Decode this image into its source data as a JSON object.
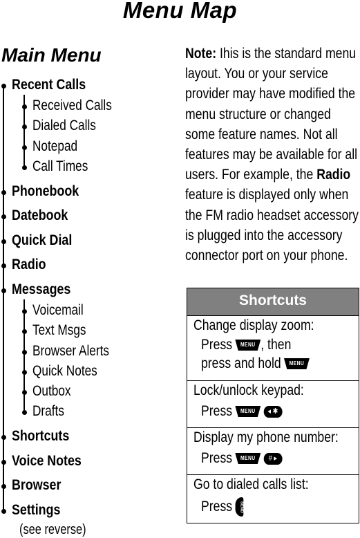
{
  "page_title": "Menu Map",
  "section_title": "Main Menu",
  "menu": [
    {
      "label": "Recent Calls",
      "children": [
        "Received Calls",
        "Dialed Calls",
        "Notepad",
        "Call Times"
      ]
    },
    {
      "label": "Phonebook",
      "children": []
    },
    {
      "label": "Datebook",
      "children": []
    },
    {
      "label": "Quick Dial",
      "children": []
    },
    {
      "label": "Radio",
      "children": []
    },
    {
      "label": "Messages",
      "children": [
        "Voicemail",
        "Text Msgs",
        "Browser Alerts",
        "Quick Notes",
        "Outbox",
        "Drafts"
      ]
    },
    {
      "label": "Shortcuts",
      "children": []
    },
    {
      "label": "Voice Notes",
      "children": []
    },
    {
      "label": "Browser",
      "children": []
    },
    {
      "label": "Settings",
      "children": [],
      "note": "(see reverse)"
    }
  ],
  "note": {
    "label": "Note:",
    "text_1": " Ihis is the standard menu layout. You or your service provider may have modified the menu structure or changed some feature names. Not all features may be available for all users. For example, the ",
    "bold": "Radio",
    "text_2": " feature is displayed only when the FM radio headset accessory is plugged into the accessory connector port on your phone."
  },
  "shortcuts": {
    "header": "Shortcuts",
    "rows": [
      {
        "label": "Change display zoom:",
        "line1": "Press",
        "line1_after": ", then",
        "line2": "press and hold"
      },
      {
        "label": "Lock/unlock keypad:",
        "line1": "Press"
      },
      {
        "label": "Display my phone number:",
        "line1": "Press"
      },
      {
        "label": "Go to dialed calls list:",
        "line1": "Press"
      }
    ],
    "keys": {
      "menu": "MENU",
      "star": "◂ ✱",
      "pound": "# ▸",
      "send": "SEND"
    }
  }
}
